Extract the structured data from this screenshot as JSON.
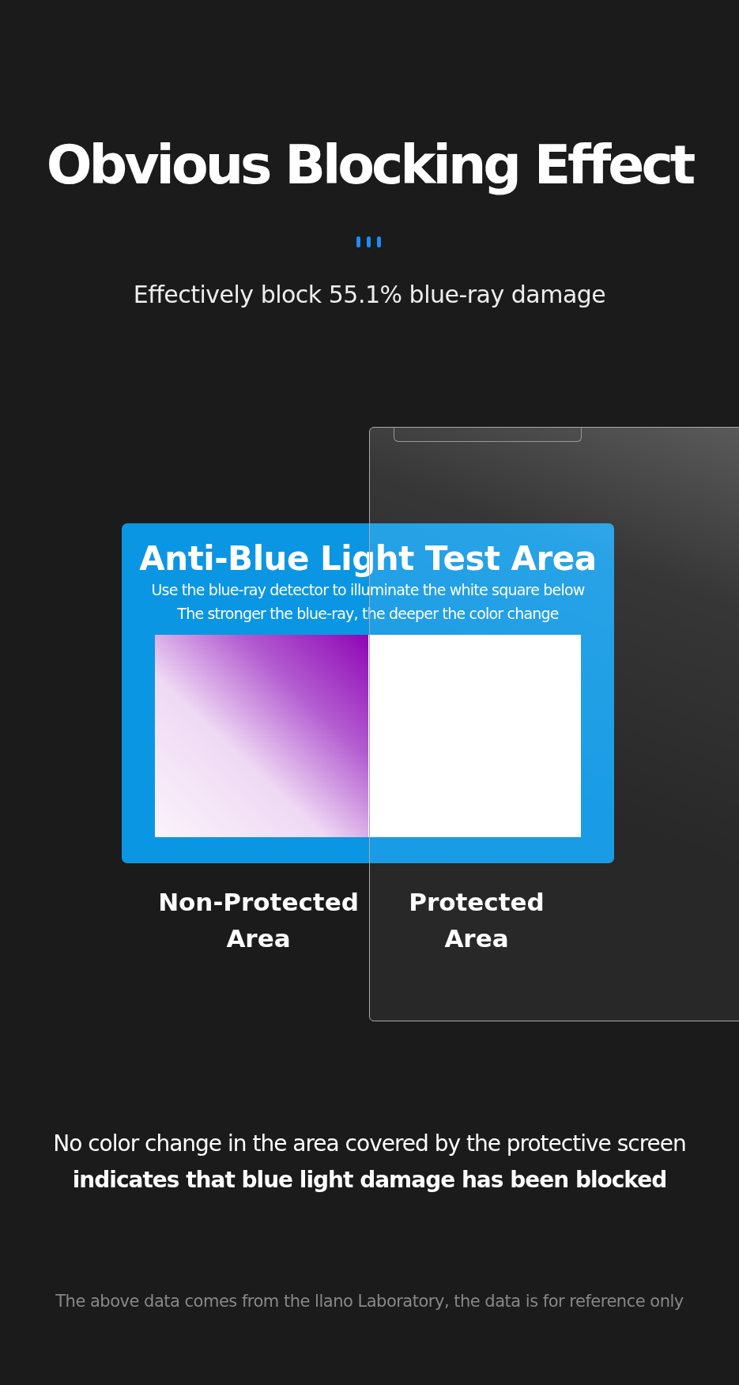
{
  "heading": {
    "title": "Obvious Blocking Effect",
    "subtitle": "Effectively block 55.1% blue-ray damage"
  },
  "test_card": {
    "title": "Anti-Blue Light Test Area",
    "lines": [
      "Use the blue-ray detector to illuminate the white square below",
      "The stronger the blue-ray, the deeper the color change"
    ]
  },
  "area_labels": [
    "Non-Protected Area",
    "Protected Area"
  ],
  "conclusion": "No color change in the area covered by the protective screen **indicates that blue light damage has been blocked**",
  "footnote": "The above data comes from the llano Laboratory, the data is for reference only"
}
